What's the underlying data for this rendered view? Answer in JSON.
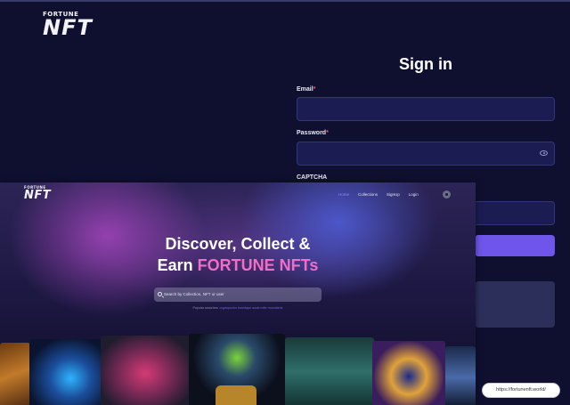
{
  "back_page": {
    "logo": {
      "top": "FORTUNE",
      "main": "NFT"
    },
    "signin": {
      "title": "Sign in",
      "email_label": "Email",
      "password_label": "Password",
      "captcha_label": "CAPTCHA",
      "required_mark": "*"
    }
  },
  "overlay": {
    "logo": {
      "top": "FORTUNE",
      "main": "NFT"
    },
    "nav": [
      {
        "label": "Home",
        "active": true
      },
      {
        "label": "Collections",
        "active": false
      },
      {
        "label": "SignUp",
        "active": false
      },
      {
        "label": "Login",
        "active": false
      }
    ],
    "hero": {
      "line1": "Discover, Collect &",
      "line2_prefix": "Earn ",
      "line2_accent": "FORTUNE NFTs"
    },
    "search": {
      "placeholder": "Search by Collection, NFT or user"
    },
    "popular": {
      "label": "Popular searches:",
      "terms": "cryptopunks boredape azuki mfer moonbirds"
    }
  },
  "url_tooltip": "https://fortunenft.world/",
  "colors": {
    "accent": "#6f55e9",
    "hero_accent": "#f06ec8",
    "background": "#0f1030",
    "required": "#ff4d6d"
  }
}
